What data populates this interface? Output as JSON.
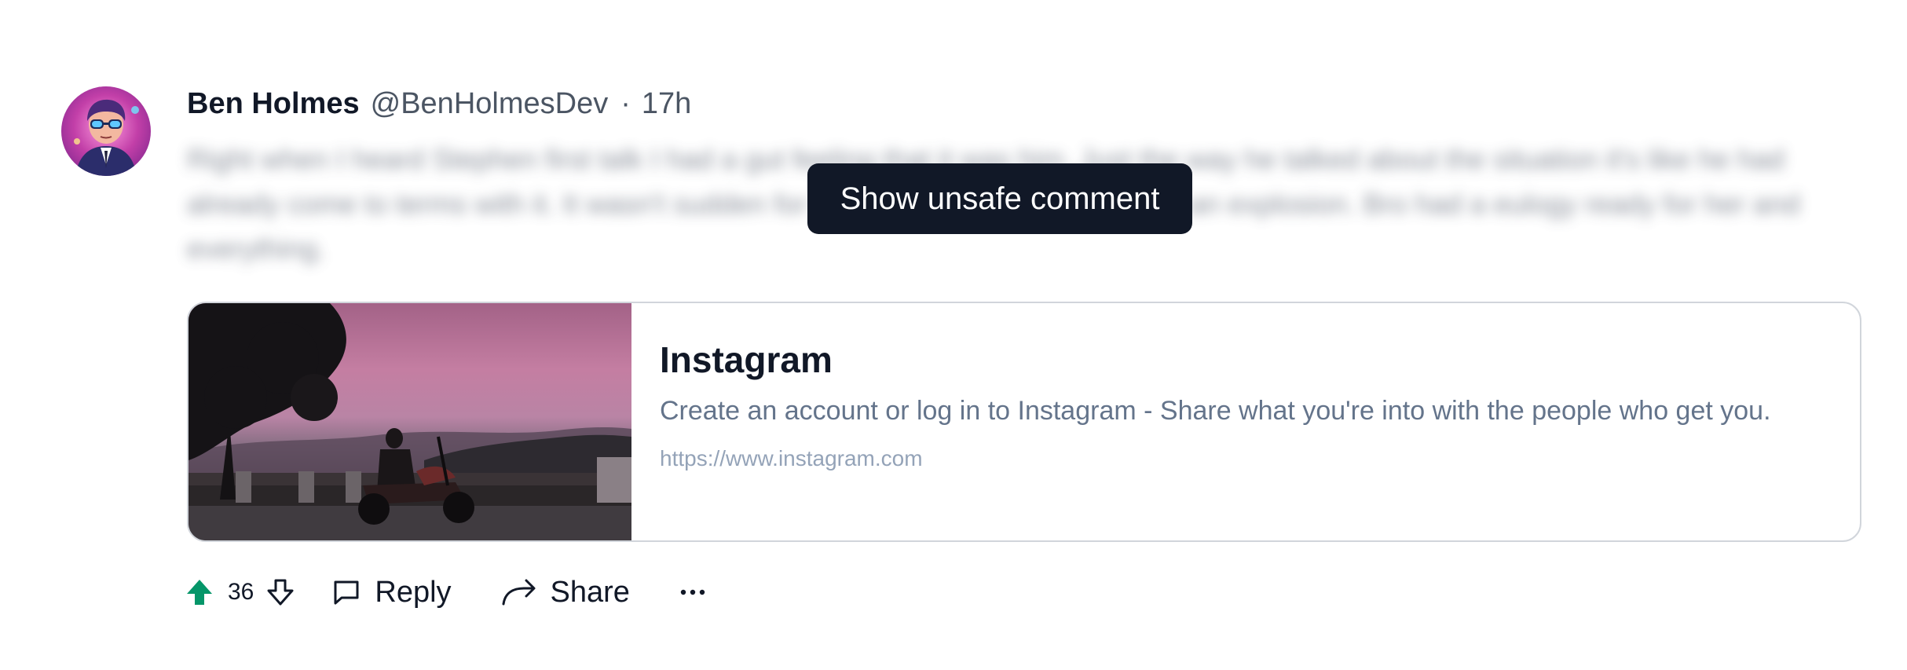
{
  "comment": {
    "author": {
      "name": "Ben Holmes",
      "handle": "@BenHolmesDev"
    },
    "separator": "·",
    "timestamp": "17h",
    "body_text": "Right when I heard Stephen first talk I had a gut feeling that it was him. Just the way he talked about the situation it's like he had already come to terms with it. It wasn't sudden for him. It was just as random as an explosion. Bro had a eulogy ready for her and everything.",
    "show_unsafe_label": "Show unsafe comment",
    "link_preview": {
      "title": "Instagram",
      "description": "Create an account or log in to Instagram - Share what you're into with the people who get you.",
      "url": "https://www.instagram.com"
    },
    "actions": {
      "vote_count": "36",
      "reply_label": "Reply",
      "share_label": "Share"
    }
  },
  "icons": {
    "upvote": "arrow-up-filled-icon",
    "downvote": "arrow-down-outline-icon",
    "reply": "speech-bubble-icon",
    "share": "share-arrow-icon",
    "more": "ellipsis-icon"
  },
  "colors": {
    "upvote_active": "#059669",
    "button_dark": "#111827",
    "text_primary": "#111827",
    "text_secondary": "#4b5563",
    "link_description": "#64748b",
    "link_url": "#94a3b8",
    "card_border": "#d1d5db"
  }
}
